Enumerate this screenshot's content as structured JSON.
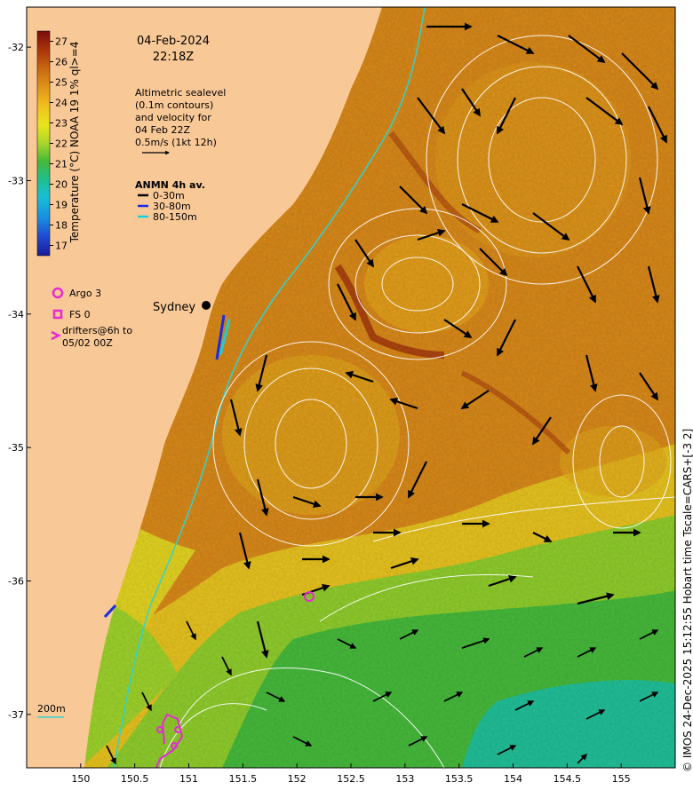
{
  "map": {
    "date": "04-Feb-2024",
    "time": "22:18Z",
    "lon_ticks": [
      "150",
      "150.5",
      "151",
      "151.5",
      "152",
      "152.5",
      "153",
      "153.5",
      "154",
      "154.5",
      "155"
    ],
    "lat_ticks": [
      "-32",
      "-33",
      "-34",
      "-35",
      "-36",
      "-37"
    ],
    "lon_range": [
      149.5,
      155.5
    ],
    "lat_range": [
      -37.4,
      -31.7
    ]
  },
  "colorbar": {
    "label": "Temperature (°C) NOAA 19 1% ql>=4",
    "ticks": [
      "27",
      "26",
      "25",
      "24",
      "23",
      "22",
      "21",
      "20",
      "19",
      "18",
      "17"
    ],
    "range": [
      16.5,
      27.5
    ],
    "colors": [
      "#7a0d0d",
      "#a8320c",
      "#c96a12",
      "#e39a1a",
      "#f2c21f",
      "#e8e51e",
      "#a9d62a",
      "#45b93a",
      "#1fbf8e",
      "#18bfd6",
      "#1a8fe0",
      "#1f4fd0",
      "#1a1a9a"
    ]
  },
  "annotations": {
    "altimetry_lines": [
      "Altimetric sealevel",
      "(0.1m contours)",
      "and velocity for",
      "04 Feb 22Z",
      "0.5m/s (1kt 12h)"
    ],
    "anmn_title": "ANMN 4h av.",
    "anmn_items": [
      {
        "label": "0-30m",
        "color": "#000000"
      },
      {
        "label": "30-80m",
        "color": "#1a2be0"
      },
      {
        "label": "80-150m",
        "color": "#18d0d8"
      }
    ],
    "city": "Sydney",
    "argo_label": "Argo 3",
    "fs_label": "FS 0",
    "drifters_lines": [
      "drifters@6h to",
      "05/02 00Z"
    ],
    "depth_label": "200m",
    "copyright": "© IMOS 24-Dec-2025 15:12:55 Hobart time Tscale=CARS+[-3 2]"
  },
  "colors": {
    "land": "#f9c897",
    "marker": "#e62ad6",
    "contour": "#ffffff",
    "shelf_line": "#2fd3d0"
  }
}
